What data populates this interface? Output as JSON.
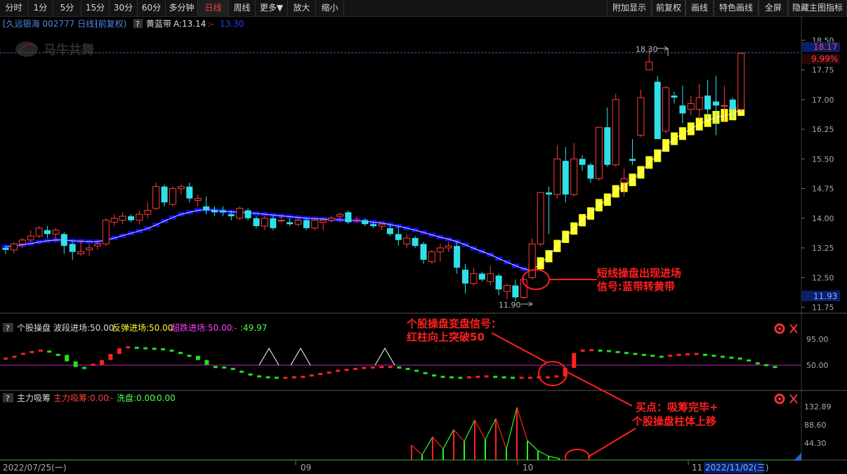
{
  "toolbar": {
    "left": [
      "分时",
      "1分",
      "5分",
      "15分",
      "30分",
      "60分",
      "多分钟",
      "日线",
      "周线",
      "更多▼",
      "放大",
      "缩小"
    ],
    "right": [
      "附加显示",
      "前复权",
      "画线",
      "特色画线",
      "全屏",
      "隐藏主图指标"
    ],
    "active": "日线"
  },
  "main_header": {
    "title": "[久远银海 002777 日线]",
    "adjust": "(前复权)",
    "help": "?",
    "indicator_name": "黄蓝带",
    "indicator_a": "A:13.14",
    "sep": ":-",
    "indicator_b": "13.30"
  },
  "watermark": "马牛共舞",
  "price_axis": {
    "ticks": [
      "18.50",
      "17.75",
      "17.00",
      "16.25",
      "15.50",
      "14.75",
      "14.00",
      "13.25",
      "12.50",
      "11.75"
    ],
    "current_high": "18.17",
    "pct": "9.99%",
    "current_low": "11.93"
  },
  "markers": {
    "high_label": "18.30",
    "low_label": "11.90"
  },
  "annotations": {
    "signal1_line1": "短线操盘出现进场",
    "signal1_line2": "信号:蓝带转黄带",
    "signal2_line1": "个股操盘变盘信号：",
    "signal2_line2": "红柱向上突破50",
    "buy_line1": "买点：吸筹完毕+",
    "buy_line2": "个股操盘柱体上移"
  },
  "sub1_header": {
    "help": "?",
    "name": "个股操盘",
    "a": "波段进场:50.00",
    "b": "反弹进场:50.00",
    "c": "超跌进场:50.00",
    "sep": ":-",
    "d": ":49.97",
    "ticks": [
      "95.00",
      "50.00"
    ]
  },
  "sub2_header": {
    "help": "?",
    "name": "主力吸筹",
    "a": "主力吸筹:0.00",
    "sep": ":-",
    "b": "洗盘:0.00",
    "c": ":0.00",
    "ticks": [
      "132.89",
      "88.60",
      "44.30"
    ]
  },
  "date_axis": {
    "start": "2022/07/25(一)",
    "labels": [
      "09",
      "10",
      "11"
    ],
    "end": "2022/11/02(三)"
  },
  "chart_data": [
    {
      "type": "candlestick",
      "title": "久远银海 002777 日线",
      "ylim": [
        11.6,
        18.7
      ],
      "series": [
        {
          "name": "久远银海",
          "ohlc": [
            [
              13.25,
              13.3,
              13.1,
              13.2
            ],
            [
              13.2,
              13.4,
              13.1,
              13.35
            ],
            [
              13.35,
              13.5,
              13.25,
              13.45
            ],
            [
              13.45,
              13.7,
              13.4,
              13.55
            ],
            [
              13.55,
              13.8,
              13.5,
              13.75
            ],
            [
              13.7,
              13.8,
              13.5,
              13.6
            ],
            [
              13.6,
              13.75,
              13.4,
              13.7
            ],
            [
              13.6,
              13.65,
              13.1,
              13.3
            ],
            [
              13.35,
              13.4,
              12.95,
              13.15
            ],
            [
              13.1,
              13.45,
              13.05,
              13.15
            ],
            [
              13.2,
              13.35,
              13.05,
              13.25
            ],
            [
              13.3,
              13.4,
              13.2,
              13.35
            ],
            [
              13.35,
              14.0,
              13.3,
              13.95
            ],
            [
              13.9,
              14.1,
              13.8,
              14.0
            ],
            [
              13.95,
              14.15,
              13.85,
              14.05
            ],
            [
              14.05,
              14.1,
              13.9,
              13.95
            ],
            [
              13.95,
              14.2,
              13.85,
              14.1
            ],
            [
              14.1,
              14.4,
              14.0,
              14.2
            ],
            [
              14.25,
              14.9,
              14.2,
              14.8
            ],
            [
              14.8,
              14.85,
              14.3,
              14.4
            ],
            [
              14.35,
              14.8,
              14.3,
              14.75
            ],
            [
              14.75,
              14.85,
              14.6,
              14.8
            ],
            [
              14.8,
              14.9,
              14.4,
              14.5
            ],
            [
              14.45,
              14.6,
              14.3,
              14.5
            ],
            [
              14.3,
              14.55,
              14.1,
              14.2
            ],
            [
              14.2,
              14.3,
              14.05,
              14.15
            ],
            [
              14.2,
              14.3,
              14.05,
              14.15
            ],
            [
              14.1,
              14.2,
              13.95,
              14.05
            ],
            [
              14.0,
              14.3,
              13.95,
              14.25
            ],
            [
              14.2,
              14.25,
              13.95,
              14.0
            ],
            [
              14.0,
              14.05,
              13.75,
              13.8
            ],
            [
              13.8,
              14.05,
              13.7,
              14.0
            ],
            [
              14.0,
              14.05,
              13.7,
              13.75
            ],
            [
              13.95,
              14.05,
              13.9,
              13.95
            ],
            [
              13.9,
              14.0,
              13.8,
              13.85
            ],
            [
              13.85,
              14.0,
              13.8,
              13.95
            ],
            [
              13.95,
              14.0,
              13.7,
              13.75
            ],
            [
              13.75,
              14.0,
              13.7,
              13.95
            ],
            [
              13.9,
              14.0,
              13.7,
              13.95
            ],
            [
              13.95,
              14.05,
              13.9,
              14.0
            ],
            [
              14.05,
              14.15,
              13.9,
              14.1
            ],
            [
              14.15,
              14.2,
              13.85,
              13.9
            ],
            [
              13.95,
              14.05,
              13.9,
              13.95
            ],
            [
              13.95,
              14.0,
              13.8,
              13.85
            ],
            [
              13.85,
              13.9,
              13.75,
              13.8
            ],
            [
              13.8,
              13.9,
              13.7,
              13.85
            ],
            [
              13.75,
              13.85,
              13.55,
              13.6
            ],
            [
              13.6,
              13.8,
              13.3,
              13.45
            ],
            [
              13.35,
              13.6,
              13.25,
              13.5
            ],
            [
              13.5,
              13.55,
              13.25,
              13.3
            ],
            [
              13.35,
              13.4,
              12.85,
              12.95
            ],
            [
              12.9,
              13.2,
              12.85,
              13.15
            ],
            [
              13.15,
              13.35,
              12.9,
              13.25
            ],
            [
              13.25,
              13.4,
              13.15,
              13.3
            ],
            [
              13.3,
              13.4,
              12.6,
              12.75
            ],
            [
              12.7,
              12.85,
              12.1,
              12.35
            ],
            [
              12.35,
              12.75,
              12.3,
              12.6
            ],
            [
              12.6,
              12.65,
              12.4,
              12.45
            ],
            [
              12.4,
              12.8,
              12.3,
              12.6
            ],
            [
              12.55,
              12.6,
              12.05,
              12.2
            ],
            [
              12.15,
              12.35,
              11.95,
              12.3
            ],
            [
              12.3,
              12.45,
              11.9,
              12.0
            ],
            [
              12.0,
              12.5,
              11.95,
              12.45
            ],
            [
              12.5,
              13.5,
              12.45,
              13.35
            ],
            [
              13.35,
              14.65,
              13.3,
              14.65
            ],
            [
              14.65,
              14.8,
              13.6,
              14.6
            ],
            [
              14.6,
              15.85,
              14.5,
              15.5
            ],
            [
              15.45,
              15.8,
              14.4,
              14.6
            ],
            [
              14.6,
              15.9,
              14.55,
              15.5
            ],
            [
              15.5,
              15.6,
              15.2,
              15.35
            ],
            [
              15.35,
              15.4,
              14.9,
              15.0
            ],
            [
              15.0,
              16.3,
              14.95,
              16.3
            ],
            [
              16.3,
              16.8,
              15.3,
              15.35
            ],
            [
              15.35,
              17.15,
              15.3,
              17.0
            ],
            [
              14.9,
              15.25,
              14.55,
              15.0
            ],
            [
              15.5,
              16.0,
              15.35,
              15.45
            ],
            [
              16.1,
              17.25,
              16.05,
              17.05
            ],
            [
              17.75,
              18.3,
              17.75,
              17.95
            ],
            [
              17.45,
              17.6,
              16.3,
              16.0
            ],
            [
              16.2,
              17.35,
              16.15,
              17.3
            ],
            [
              17.1,
              17.2,
              16.9,
              17.05
            ],
            [
              16.85,
              17.35,
              16.4,
              16.65
            ],
            [
              16.75,
              17.1,
              16.6,
              16.9
            ],
            [
              16.75,
              17.4,
              16.5,
              17.05
            ],
            [
              17.1,
              17.5,
              16.5,
              16.75
            ],
            [
              16.95,
              17.6,
              16.1,
              16.85
            ],
            [
              16.85,
              17.35,
              16.45,
              16.85
            ],
            [
              17.0,
              17.05,
              16.5,
              16.75
            ],
            [
              16.75,
              18.17,
              16.7,
              18.17
            ]
          ]
        }
      ],
      "band": {
        "name": "黄蓝带",
        "values": [
          13.28,
          13.3,
          13.33,
          13.36,
          13.4,
          13.43,
          13.45,
          13.45,
          13.43,
          13.42,
          13.41,
          13.41,
          13.45,
          13.5,
          13.56,
          13.62,
          13.68,
          13.74,
          13.83,
          13.93,
          14.02,
          14.1,
          14.15,
          14.2,
          14.22,
          14.2,
          14.18,
          14.16,
          14.15,
          14.14,
          14.12,
          14.1,
          14.08,
          14.06,
          14.04,
          14.02,
          14.0,
          13.99,
          13.98,
          13.97,
          13.96,
          13.95,
          13.94,
          13.92,
          13.9,
          13.88,
          13.84,
          13.8,
          13.75,
          13.7,
          13.64,
          13.58,
          13.52,
          13.47,
          13.41,
          13.33,
          13.24,
          13.16,
          13.08,
          12.98,
          12.89,
          12.8,
          12.72,
          12.68,
          12.86,
          13.04,
          13.3,
          13.53,
          13.74,
          13.95,
          14.12,
          14.33,
          14.47,
          14.68,
          14.82,
          14.97,
          15.16,
          15.41,
          15.58,
          15.84,
          16.01,
          16.14,
          16.26,
          16.38,
          16.47,
          16.55,
          16.6,
          16.64,
          16.75
        ],
        "color_switch_index": 63
      }
    },
    {
      "type": "bar",
      "title": "个股操盘",
      "ylim": [
        0,
        120
      ],
      "reference": 50,
      "values": [
        68,
        72,
        78,
        82,
        85,
        83,
        76,
        62,
        50,
        48,
        55,
        65,
        78,
        90,
        92,
        91,
        90,
        89,
        88,
        85,
        80,
        74,
        65,
        55,
        50,
        49,
        46,
        40,
        34,
        30,
        28,
        27,
        27,
        28,
        29,
        32,
        35,
        38,
        42,
        44,
        46,
        48,
        49,
        50,
        50,
        49,
        46,
        42,
        37,
        32,
        29,
        28,
        27,
        28,
        29,
        30,
        29,
        28,
        27,
        27,
        27,
        28,
        28,
        30,
        48,
        80,
        85,
        86,
        85,
        84,
        82,
        80,
        78,
        76,
        74,
        72,
        74,
        76,
        77,
        78,
        76,
        74,
        72,
        70,
        68,
        64,
        58,
        54,
        50
      ],
      "markers": [
        "△",
        "△",
        "△"
      ]
    },
    {
      "type": "bar",
      "title": "主力吸筹",
      "ylim": [
        0,
        150
      ],
      "series": [
        {
          "name": "主力吸筹",
          "values": [
            0,
            0,
            0,
            0,
            0,
            0,
            0,
            0,
            0,
            0,
            0,
            0,
            0,
            0,
            0,
            0,
            0,
            0,
            0,
            0,
            0,
            0,
            0,
            0,
            0,
            0,
            0,
            0,
            0,
            0,
            0,
            0,
            0,
            0,
            0,
            0,
            0,
            0,
            0,
            0,
            0,
            0,
            0,
            0,
            0,
            0,
            0,
            0,
            0,
            0,
            0,
            0,
            0,
            0,
            0,
            0,
            0,
            0,
            0,
            0,
            0,
            0,
            0,
            0,
            0,
            0,
            0,
            0,
            0,
            0,
            0,
            0,
            0,
            0,
            0,
            0,
            0,
            0,
            0,
            0,
            0,
            0,
            0,
            0,
            0,
            0,
            0,
            0,
            0
          ]
        },
        {
          "name": "洗盘",
          "values": [
            0,
            0,
            0,
            0,
            0,
            0,
            0,
            0,
            0,
            0,
            0,
            0,
            0,
            0,
            0,
            0,
            0,
            0,
            0,
            0,
            0,
            0,
            0,
            0,
            0,
            0,
            0,
            0,
            0,
            0,
            0,
            0,
            0,
            0,
            0,
            0,
            0,
            0,
            0,
            0,
            0,
            0,
            0,
            0,
            0,
            0,
            0,
            0,
            0,
            0,
            0,
            0,
            0,
            0,
            0,
            0,
            0,
            0,
            0,
            0,
            0,
            0,
            0,
            0,
            0,
            0,
            0,
            0,
            0,
            0,
            0,
            0,
            0,
            0,
            0,
            0,
            0,
            0,
            0,
            0,
            0,
            0,
            0,
            0,
            0,
            0,
            0,
            0,
            0
          ]
        }
      ],
      "spikes": [
        {
          "i": 39,
          "red": 40,
          "green": 0
        },
        {
          "i": 40,
          "red": 0,
          "green": 14
        },
        {
          "i": 41,
          "red": 62,
          "green": 0
        },
        {
          "i": 42,
          "red": 0,
          "green": 30
        },
        {
          "i": 43,
          "red": 82,
          "green": 0
        },
        {
          "i": 44,
          "red": 0,
          "green": 50
        },
        {
          "i": 45,
          "red": 108,
          "green": 0
        },
        {
          "i": 46,
          "red": 0,
          "green": 55
        },
        {
          "i": 47,
          "red": 112,
          "green": 0
        },
        {
          "i": 48,
          "red": 0,
          "green": 30
        },
        {
          "i": 49,
          "red": 142,
          "green": 0
        },
        {
          "i": 50,
          "red": 0,
          "green": 52
        },
        {
          "i": 51,
          "red": 0,
          "green": 25
        },
        {
          "i": 52,
          "red": 0,
          "green": 10
        },
        {
          "i": 53,
          "red": 0,
          "green": 4
        }
      ]
    }
  ]
}
